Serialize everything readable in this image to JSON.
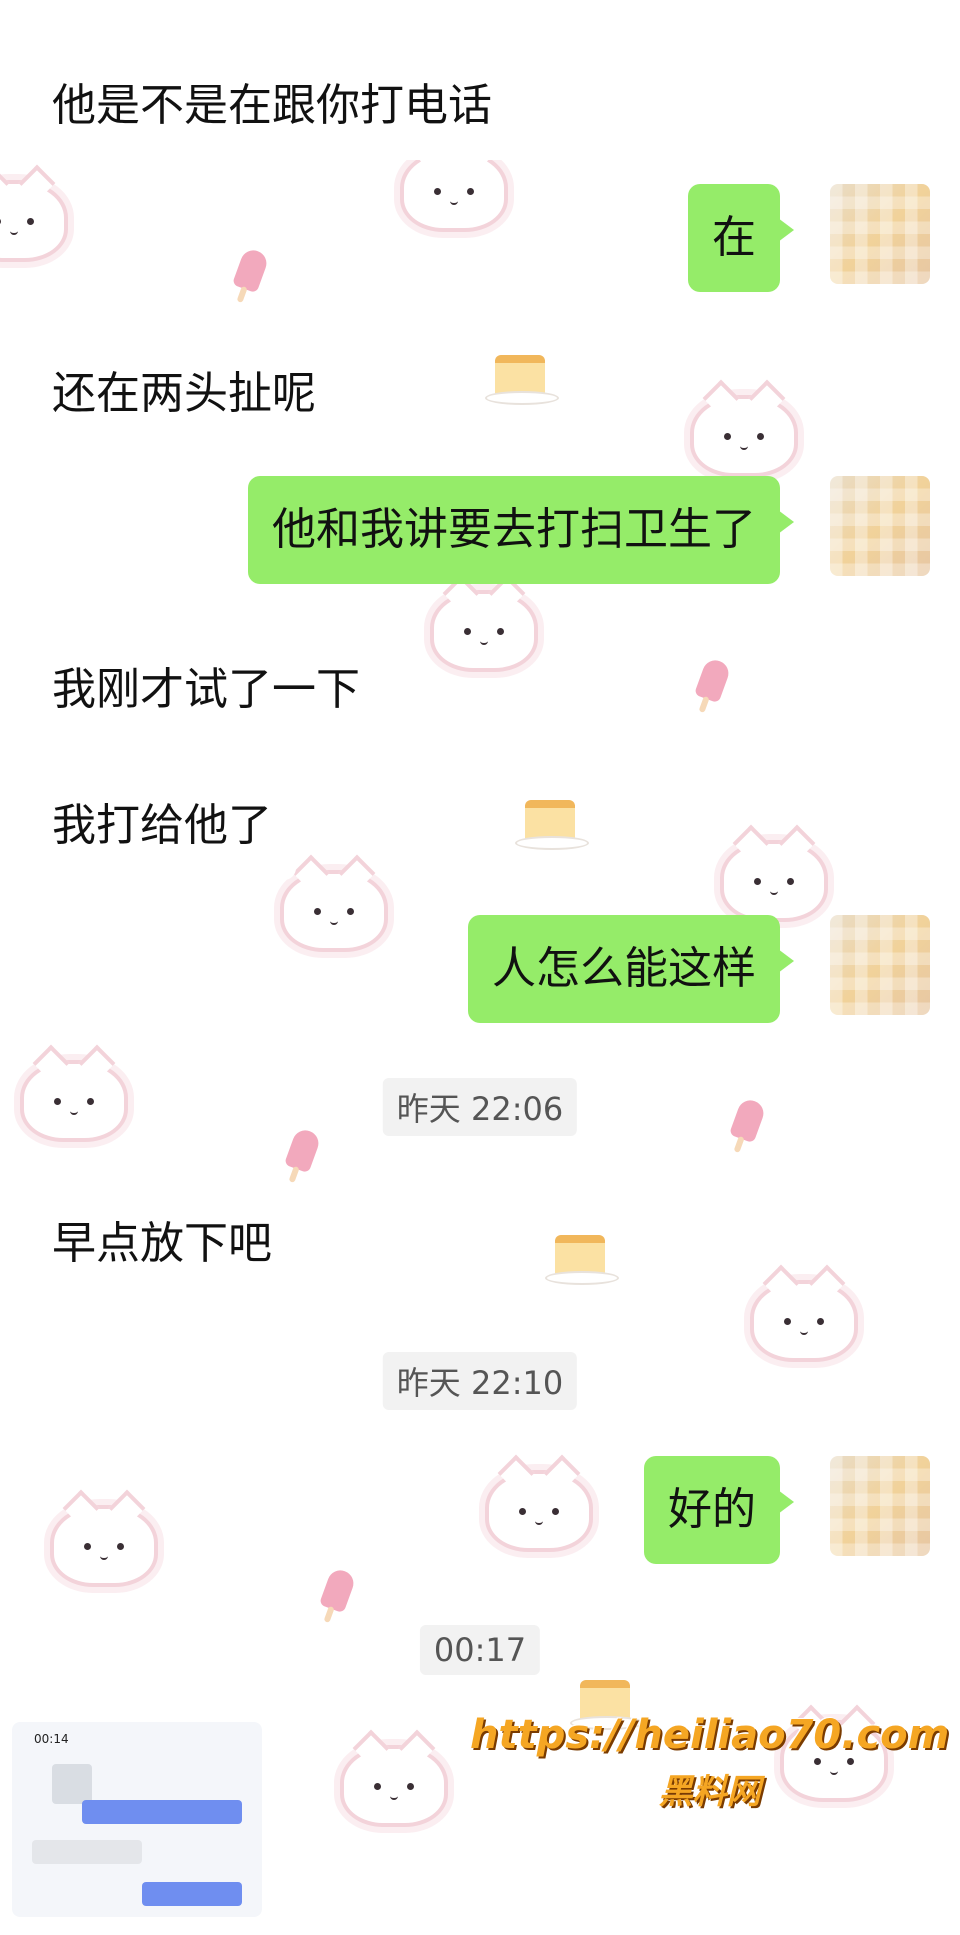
{
  "colors": {
    "outgoing_bubble": "#95ec69",
    "incoming_bubble": "#ffffff",
    "background": "#ffffff",
    "watermark": "#f5a623"
  },
  "messages": [
    {
      "side": "in",
      "text": "他是不是在跟你打电话"
    },
    {
      "side": "out",
      "text": "在"
    },
    {
      "side": "in",
      "text": "还在两头扯呢"
    },
    {
      "side": "out",
      "text": "他和我讲要去打扫卫生了"
    },
    {
      "side": "in",
      "text": "我刚才试了一下"
    },
    {
      "side": "in",
      "text": "我打给他了"
    },
    {
      "side": "out",
      "text": "人怎么能这样"
    },
    {
      "side": "in",
      "text": "早点放下吧"
    },
    {
      "side": "out",
      "text": "好的"
    }
  ],
  "timestamps": [
    "昨天 22:06",
    "昨天 22:10",
    "00:17"
  ],
  "thumbnail": {
    "status_time": "00:14"
  },
  "watermark": {
    "url": "https://heiliao70.com",
    "name": "黑料网"
  },
  "icons": {
    "avatar": "blurred-avatar-icon",
    "background": "cat-sticker-pattern"
  }
}
